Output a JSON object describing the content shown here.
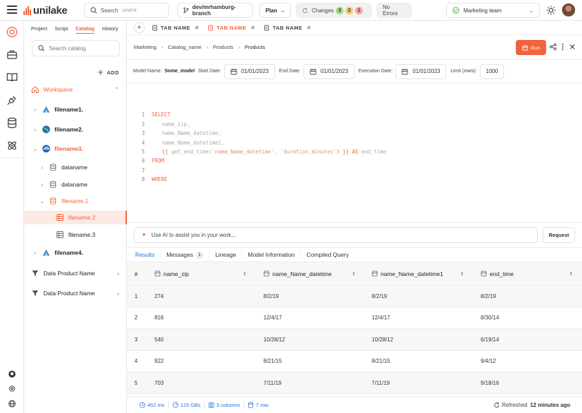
{
  "brand": {
    "name": "unilake",
    "accent": "#f0643c"
  },
  "topbar": {
    "search_label": "Search",
    "search_shortcut": "cmd+k",
    "branch": "dev/mrhamburg-branch",
    "plan_label": "Plan",
    "changes_label": "Changes",
    "changes_counts": [
      "3",
      "2",
      "1"
    ],
    "errors_label": "No Errors",
    "team": "Marketing team"
  },
  "catalog": {
    "tabs": [
      "Project",
      "Script",
      "Catalog",
      "History"
    ],
    "active_tab": "Catalog",
    "search_placeholder": "Search catalog",
    "add_label": "ADD",
    "workspace_label": "Workspace",
    "items": [
      {
        "label": "filename1.",
        "icon": "triangle-logo-icon"
      },
      {
        "label": "filename2.",
        "icon": "globe-icon"
      },
      {
        "label": "filename3.",
        "icon": "edge-logo-icon"
      },
      {
        "label": "dataname",
        "icon": "database-icon"
      },
      {
        "label": "dataname",
        "icon": "database-icon"
      },
      {
        "label": "filename.1",
        "icon": "database-icon"
      },
      {
        "label": "filename.2",
        "icon": "table-icon"
      },
      {
        "label": "filename.3",
        "icon": "table-icon"
      },
      {
        "label": "filename4.",
        "icon": "triangle-logo-icon"
      }
    ],
    "products": [
      "Data Product Name",
      "Data Product Name"
    ]
  },
  "tabs": [
    {
      "label": "TAB NAME",
      "active": false
    },
    {
      "label": "TAB NAME",
      "active": true
    },
    {
      "label": "TAB NAME",
      "active": false
    }
  ],
  "breadcrumb": [
    "Marketing",
    "Catalog_name",
    "Products",
    "Products"
  ],
  "run_label": "Run",
  "params": {
    "model_name_label": "Model Name:",
    "model_name": "Some_model",
    "start_label": "Start Date:",
    "start": "01/01/2023",
    "end_label": "End Date:",
    "end": "01/01/2023",
    "exec_label": "Execution Date:",
    "exec": "01/01/2023",
    "limit_label": "Limit (rows):",
    "limit": "1000"
  },
  "code": {
    "line_numbers": [
      "1",
      "2",
      "3",
      "4",
      "5",
      "6",
      "7",
      "8"
    ],
    "select": "SELECT",
    "col1": "name_zip,",
    "col2": "name_Name_datetime,",
    "col3": "name_Name_datetime1,",
    "l5_open": "{{ ",
    "l5_fn": "get_end_time(",
    "l5_arg1": "'name_Name_datetime'",
    "l5_comma": ", ",
    "l5_arg2": "'duration_minutes'",
    "l5_close": ") }}",
    "l5_as": " AS ",
    "l5_alias": "end_time",
    "from": "FROM",
    "where": "WHERE"
  },
  "ai": {
    "placeholder": "Use AI to assist you in your work...",
    "request_label": "Request"
  },
  "result_tabs": {
    "results": "Results",
    "messages": "Messages",
    "messages_count": "1",
    "lineage": "Lineage",
    "model_info": "Model Information",
    "compiled": "Compiled Query"
  },
  "table": {
    "headers": [
      "#",
      "name_zip",
      "name_Name_datetime",
      "name_Name_datetime1",
      "end_time"
    ],
    "rows": [
      [
        "1",
        "274",
        "8/2/19",
        "8/2/19",
        "8/2/19"
      ],
      [
        "2",
        "816",
        "12/4/17",
        "12/4/17",
        "8/30/14"
      ],
      [
        "3",
        "540",
        "10/28/12",
        "10/28/12",
        "6/19/14"
      ],
      [
        "4",
        "922",
        "8/21/15",
        "8/21/15",
        "9/4/12"
      ],
      [
        "5",
        "703",
        "7/11/19",
        "7/11/19",
        "9/18/16"
      ]
    ]
  },
  "status": {
    "time": "452 ms",
    "size": "125 GBs",
    "columns": "3 columns",
    "rows": "7 row",
    "refreshed_label": "Refreshed",
    "refreshed_ago": "12 minutes ago"
  }
}
